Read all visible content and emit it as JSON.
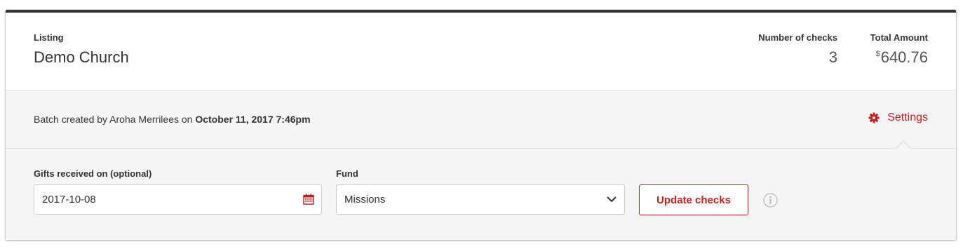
{
  "header": {
    "listing_label": "Listing",
    "listing_name": "Demo Church",
    "checks_label": "Number of checks",
    "checks_value": "3",
    "total_label": "Total Amount",
    "total_currency": "$",
    "total_value": "640.76"
  },
  "batch": {
    "prefix": "Batch created by Aroha Merrilees on ",
    "date": "October 11, 2017 7:46pm",
    "settings_label": "Settings",
    "settings_icon": "gear-icon"
  },
  "form": {
    "gifts_label": "Gifts received on (optional)",
    "gifts_value": "2017-10-08",
    "calendar_icon": "calendar-icon",
    "fund_label": "Fund",
    "fund_value": "Missions",
    "update_button": "Update checks",
    "info_icon": "info-icon"
  },
  "colors": {
    "accent": "#c41d1d",
    "top_border": "#333333",
    "panel_bg": "#f5f5f5"
  }
}
